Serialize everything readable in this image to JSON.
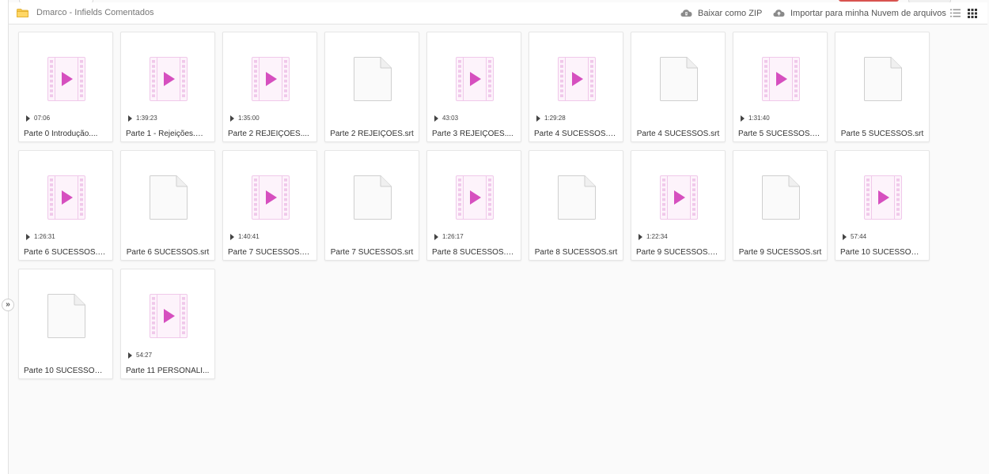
{
  "header": {
    "folder_title": "Dmarco - Infields Comentados",
    "download_zip_label": "Baixar como ZIP",
    "import_cloud_label": "Importar para minha Nuvem de arquivos",
    "folder_color": "#f5c84c"
  },
  "sidebar": {
    "toggle_glyph": "»"
  },
  "colors": {
    "video_accent": "#d64fbf",
    "video_frame": "#f0c8ea",
    "doc_border": "#cfcfcf"
  },
  "files": [
    {
      "name": "Parte 0 Introdução.mp4",
      "display": "Parte 0 Introdução....",
      "type": "video",
      "duration": "07:06"
    },
    {
      "name": "Parte 1 - Rejeições.mp4",
      "display": "Parte 1 - Rejeições.mp4",
      "type": "video",
      "duration": "1:39:23"
    },
    {
      "name": "Parte 2 REJEIÇÕES.mp4",
      "display": "Parte 2 REJEIÇÕES....",
      "type": "video",
      "duration": "1:35:00"
    },
    {
      "name": "Parte 2 REJEIÇÕES.srt",
      "display": "Parte 2 REJEIÇÕES.srt",
      "type": "doc",
      "duration": ""
    },
    {
      "name": "Parte 3 REJEIÇÕES.mp4",
      "display": "Parte 3 REJEIÇÕES....",
      "type": "video",
      "duration": "43:03"
    },
    {
      "name": "Parte 4 SUCESSOS.mp4",
      "display": "Parte 4 SUCESSOS.m...",
      "type": "video",
      "duration": "1:29:28"
    },
    {
      "name": "Parte 4 SUCESSOS.srt",
      "display": "Parte 4 SUCESSOS.srt",
      "type": "doc",
      "duration": ""
    },
    {
      "name": "Parte 5 SUCESSOS.mp4",
      "display": "Parte 5 SUCESSOS.m...",
      "type": "video",
      "duration": "1:31:40"
    },
    {
      "name": "Parte 5 SUCESSOS.srt",
      "display": "Parte 5 SUCESSOS.srt",
      "type": "doc",
      "duration": ""
    },
    {
      "name": "Parte 6 SUCESSOS.mp4",
      "display": "Parte 6 SUCESSOS.m...",
      "type": "video",
      "duration": "1:26:31"
    },
    {
      "name": "Parte 6 SUCESSOS.srt",
      "display": "Parte 6 SUCESSOS.srt",
      "type": "doc",
      "duration": ""
    },
    {
      "name": "Parte 7 SUCESSOS.mp4",
      "display": "Parte 7 SUCESSOS.m...",
      "type": "video",
      "duration": "1:40:41"
    },
    {
      "name": "Parte 7 SUCESSOS.srt",
      "display": "Parte 7 SUCESSOS.srt",
      "type": "doc",
      "duration": ""
    },
    {
      "name": "Parte 8 SUCESSOS.mp4",
      "display": "Parte 8 SUCESSOS.m...",
      "type": "video",
      "duration": "1:26:17"
    },
    {
      "name": "Parte 8 SUCESSOS.srt",
      "display": "Parte 8 SUCESSOS.srt",
      "type": "doc",
      "duration": ""
    },
    {
      "name": "Parte 9 SUCESSOS.mp4",
      "display": "Parte 9 SUCESSOS.m...",
      "type": "video",
      "duration": "1:22:34"
    },
    {
      "name": "Parte 9 SUCESSOS.srt",
      "display": "Parte 9 SUCESSOS.srt",
      "type": "doc",
      "duration": ""
    },
    {
      "name": "Parte 10 SUCESSOS.mp4",
      "display": "Parte 10 SUCESSOS....",
      "type": "video",
      "duration": "57:44"
    },
    {
      "name": "Parte 10 SUCESSOS.srt",
      "display": "Parte 10 SUCESSOS.srt",
      "type": "doc",
      "duration": ""
    },
    {
      "name": "Parte 11 PERSONALIDADE.mp4",
      "display": "Parte 11 PERSONALI...",
      "type": "video",
      "duration": "54:27"
    }
  ]
}
